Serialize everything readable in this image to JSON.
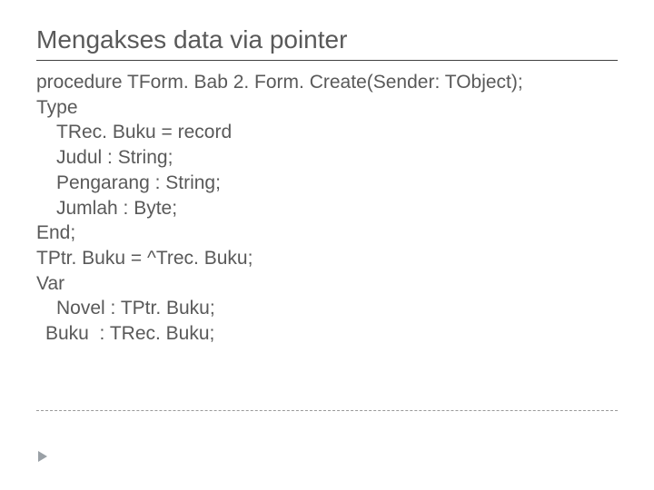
{
  "title": "Mengakses data via pointer",
  "code": {
    "l0": "procedure TForm. Bab 2. Form. Create(Sender: TObject);",
    "l1": "Type",
    "l2": "TRec. Buku = record",
    "l3": "Judul : String;",
    "l4": "Pengarang : String;",
    "l5": "Jumlah : Byte;",
    "l6": "End;",
    "l7": "TPtr. Buku = ^Trec. Buku;",
    "l8": "Var",
    "l9": "Novel : TPtr. Buku;",
    "l10": "Buku  : TRec. Buku;"
  }
}
